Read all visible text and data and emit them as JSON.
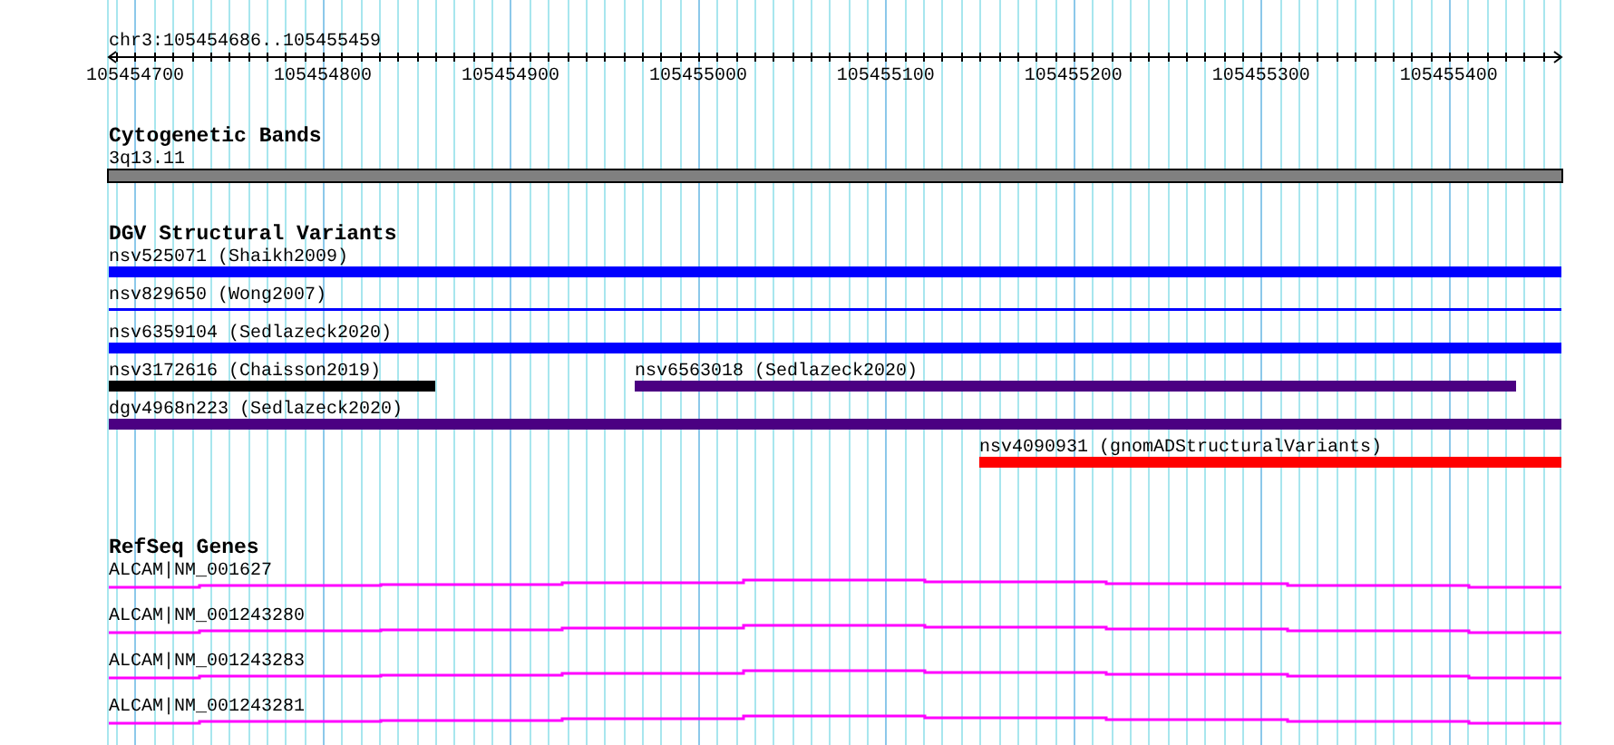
{
  "ruler": {
    "location": "chr3:105454686..105455459",
    "ticks": [
      "105454700",
      "105454800",
      "105454900",
      "105455000",
      "105455100",
      "105455200",
      "105455300",
      "105455400"
    ]
  },
  "tracks": [
    {
      "title": "Cytogenetic Bands",
      "features": [
        {
          "label": "3q13.11",
          "kind": "band"
        }
      ]
    },
    {
      "title": "DGV Structural Variants",
      "features": [
        {
          "label": "nsv525071 (Shaikh2009)",
          "kind": "bar",
          "color": "#0000ff"
        },
        {
          "label": "nsv829650 (Wong2007)",
          "kind": "line",
          "color": "#0000ff"
        },
        {
          "label": "nsv6359104 (Sedlazeck2020)",
          "kind": "bar",
          "color": "#0000ff"
        },
        {
          "label": "nsv3172616 (Chaisson2019)",
          "kind": "bar",
          "color": "#000000"
        },
        {
          "label": "nsv6563018 (Sedlazeck2020)",
          "kind": "bar",
          "color": "#4b0082"
        },
        {
          "label": "dgv4968n223 (Sedlazeck2020)",
          "kind": "bar",
          "color": "#4b0082"
        },
        {
          "label": "nsv4090931 (gnomADStructuralVariants)",
          "kind": "bar",
          "color": "#ff0000"
        }
      ]
    },
    {
      "title": "RefSeq Genes",
      "features": [
        {
          "label": "ALCAM|NM_001627",
          "kind": "gene"
        },
        {
          "label": "ALCAM|NM_001243280",
          "kind": "gene"
        },
        {
          "label": "ALCAM|NM_001243283",
          "kind": "gene"
        },
        {
          "label": "ALCAM|NM_001243281",
          "kind": "gene"
        }
      ]
    }
  ]
}
